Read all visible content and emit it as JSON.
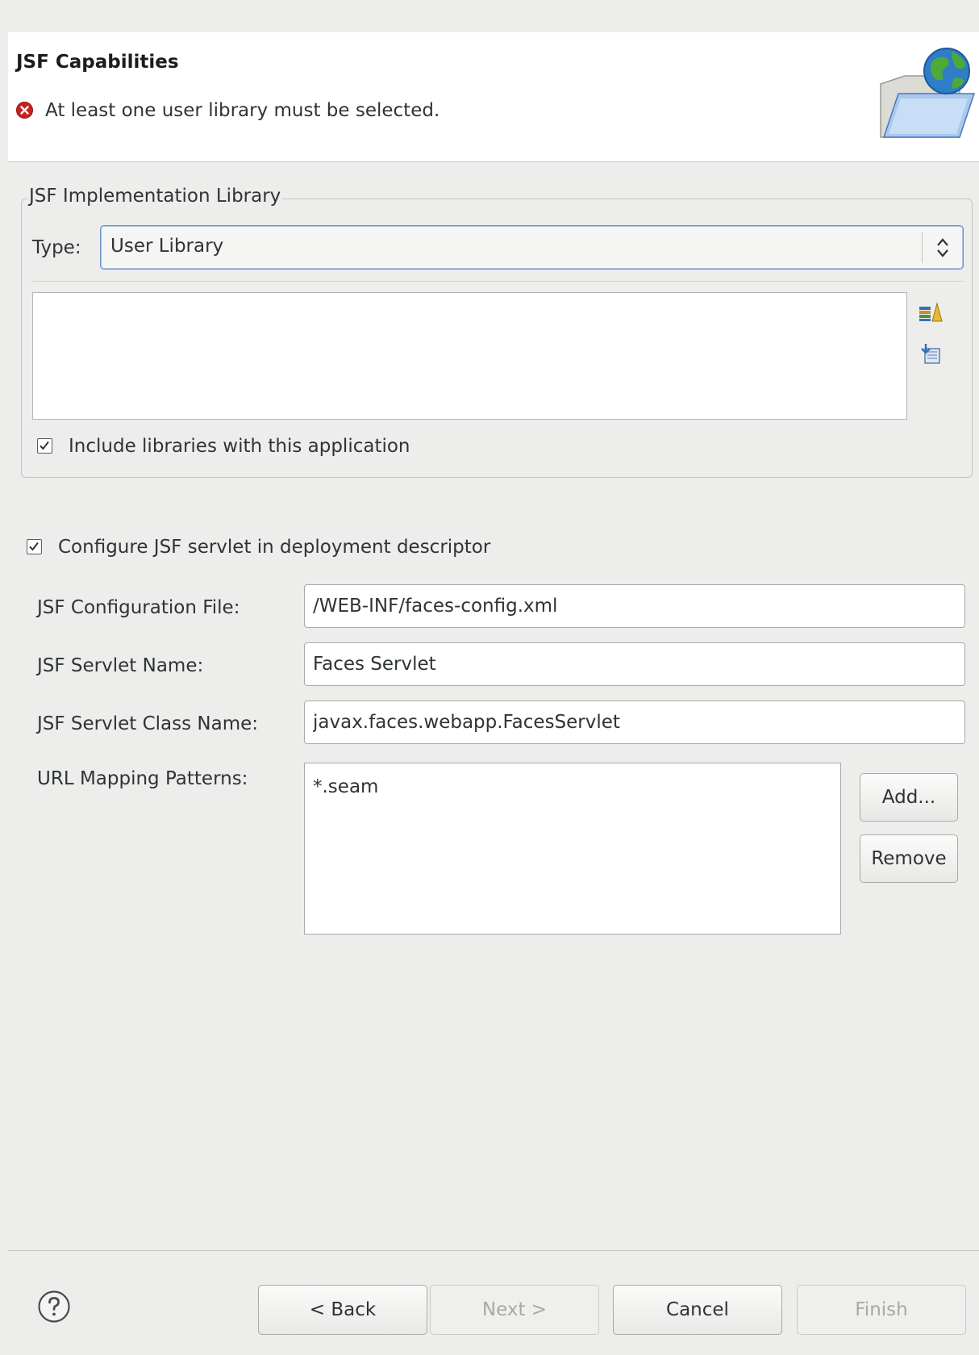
{
  "header": {
    "title": "JSF Capabilities",
    "error_message": "At least one user library must be selected."
  },
  "implementation_group": {
    "title": "JSF Implementation Library",
    "type_label": "Type:",
    "type_value": "User Library",
    "include_checkbox_checked": true,
    "include_checkbox_label": "Include libraries with this application"
  },
  "servlet": {
    "configure_checked": true,
    "configure_label": "Configure JSF servlet in deployment descriptor",
    "config_file_label": "JSF Configuration File:",
    "config_file_value": "/WEB-INF/faces-config.xml",
    "servlet_name_label": "JSF Servlet Name:",
    "servlet_name_value": "Faces Servlet",
    "servlet_class_label": "JSF Servlet Class Name:",
    "servlet_class_value": "javax.faces.webapp.FacesServlet",
    "url_mapping_label": "URL Mapping Patterns:",
    "url_patterns": [
      "*.seam"
    ],
    "add_button": "Add...",
    "remove_button": "Remove"
  },
  "footer": {
    "back": "< Back",
    "next": "Next >",
    "cancel": "Cancel",
    "finish": "Finish"
  },
  "colors": {
    "dialog_bg": "#ededec",
    "header_bg": "#ffffff",
    "error_red": "#cc2020",
    "combo_focus": "#6d8fc4"
  }
}
